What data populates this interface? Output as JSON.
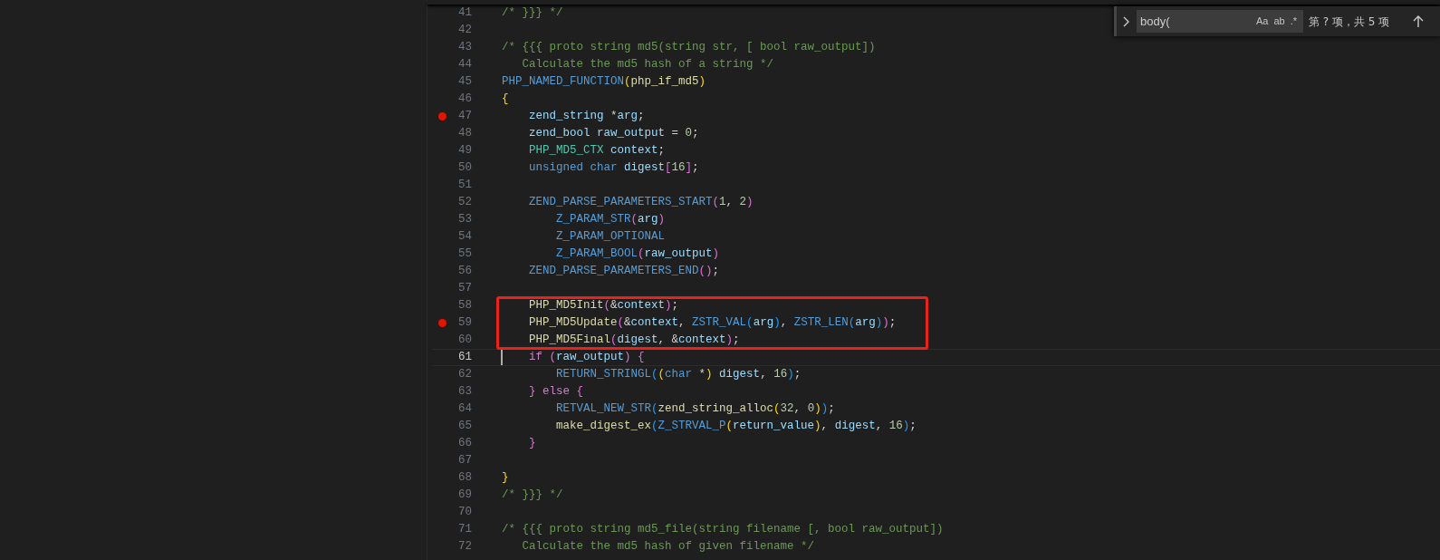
{
  "find_widget": {
    "value": "body(",
    "toggles": [
      {
        "label": "Aa",
        "selected": false
      },
      {
        "label": "ab",
        "selected": false
      },
      {
        "label": ".*",
        "selected": false
      }
    ],
    "result": "第 ? 项，共 5 项"
  },
  "lines": [
    {
      "number": "41",
      "tokens": [
        {
          "kind": "c",
          "text": "/* }}} */"
        }
      ]
    },
    {
      "number": "42"
    },
    {
      "number": "43",
      "tokens": [
        {
          "kind": "c",
          "text": "/* {{{ proto string md5(string str, [ bool raw_output])"
        }
      ]
    },
    {
      "number": "44",
      "tokens": [
        {
          "kind": "c",
          "text": "   Calculate the md5 hash of a string */"
        }
      ]
    },
    {
      "number": "45",
      "tokens": [
        {
          "kind": "m",
          "text": "PHP_NAMED_FUNCTION"
        },
        {
          "kind": "b1",
          "text": "("
        },
        {
          "kind": "f",
          "text": "php_if_md5"
        },
        {
          "kind": "b1",
          "text": ")"
        }
      ]
    },
    {
      "number": "46",
      "tokens": [
        {
          "kind": "b1",
          "text": "{"
        }
      ]
    },
    {
      "number": "47",
      "breakpoint": true,
      "tokens": [
        {
          "kind": "v",
          "text": "    zend_string"
        },
        {
          "kind": "p",
          "text": " *"
        },
        {
          "kind": "v",
          "text": "arg"
        },
        {
          "kind": "p",
          "text": ";"
        }
      ]
    },
    {
      "number": "48",
      "tokens": [
        {
          "kind": "v",
          "text": "    zend_bool raw_output"
        },
        {
          "kind": "p",
          "text": " = "
        },
        {
          "kind": "n",
          "text": "0"
        },
        {
          "kind": "p",
          "text": ";"
        }
      ]
    },
    {
      "number": "49",
      "tokens": [
        {
          "kind": "t",
          "text": "    PHP_MD5_CTX"
        },
        {
          "kind": "v",
          "text": " context"
        },
        {
          "kind": "p",
          "text": ";"
        }
      ]
    },
    {
      "number": "50",
      "tokens": [
        {
          "kind": "k",
          "text": "    unsigned char"
        },
        {
          "kind": "v",
          "text": " digest"
        },
        {
          "kind": "b2",
          "text": "["
        },
        {
          "kind": "n",
          "text": "16"
        },
        {
          "kind": "b2",
          "text": "]"
        },
        {
          "kind": "p",
          "text": ";"
        }
      ]
    },
    {
      "number": "51"
    },
    {
      "number": "52",
      "tokens": [
        {
          "kind": "m",
          "text": "    ZEND_PARSE_PARAMETERS_START"
        },
        {
          "kind": "b2",
          "text": "("
        },
        {
          "kind": "n",
          "text": "1"
        },
        {
          "kind": "p",
          "text": ", "
        },
        {
          "kind": "n",
          "text": "2"
        },
        {
          "kind": "b2",
          "text": ")"
        }
      ]
    },
    {
      "number": "53",
      "tokens": [
        {
          "kind": "m",
          "text": "        Z_PARAM_STR"
        },
        {
          "kind": "b2",
          "text": "("
        },
        {
          "kind": "v",
          "text": "arg"
        },
        {
          "kind": "b2",
          "text": ")"
        }
      ]
    },
    {
      "number": "54",
      "tokens": [
        {
          "kind": "m",
          "text": "        Z_PARAM_OPTIONAL"
        }
      ]
    },
    {
      "number": "55",
      "tokens": [
        {
          "kind": "m",
          "text": "        Z_PARAM_BOOL"
        },
        {
          "kind": "b2",
          "text": "("
        },
        {
          "kind": "v",
          "text": "raw_output"
        },
        {
          "kind": "b2",
          "text": ")"
        }
      ]
    },
    {
      "number": "56",
      "tokens": [
        {
          "kind": "m",
          "text": "    ZEND_PARSE_PARAMETERS_END"
        },
        {
          "kind": "b2",
          "text": "()"
        },
        {
          "kind": "p",
          "text": ";"
        }
      ]
    },
    {
      "number": "57"
    },
    {
      "number": "58",
      "boxed": true,
      "tokens": [
        {
          "kind": "f",
          "text": "    PHP_MD5Init"
        },
        {
          "kind": "b2",
          "text": "("
        },
        {
          "kind": "p",
          "text": "&"
        },
        {
          "kind": "v",
          "text": "context"
        },
        {
          "kind": "b2",
          "text": ")"
        },
        {
          "kind": "p",
          "text": ";"
        }
      ]
    },
    {
      "number": "59",
      "boxed": true,
      "breakpoint": true,
      "tokens": [
        {
          "kind": "f",
          "text": "    PHP_MD5Update"
        },
        {
          "kind": "b2",
          "text": "("
        },
        {
          "kind": "p",
          "text": "&"
        },
        {
          "kind": "v",
          "text": "context"
        },
        {
          "kind": "p",
          "text": ", "
        },
        {
          "kind": "m",
          "text": "ZSTR_VAL"
        },
        {
          "kind": "b3",
          "text": "("
        },
        {
          "kind": "v",
          "text": "arg"
        },
        {
          "kind": "b3",
          "text": ")"
        },
        {
          "kind": "p",
          "text": ", "
        },
        {
          "kind": "m",
          "text": "ZSTR_LEN"
        },
        {
          "kind": "b3",
          "text": "("
        },
        {
          "kind": "v",
          "text": "arg"
        },
        {
          "kind": "b3",
          "text": ")"
        },
        {
          "kind": "b2",
          "text": ")"
        },
        {
          "kind": "p",
          "text": ";"
        }
      ]
    },
    {
      "number": "60",
      "boxed": true,
      "tokens": [
        {
          "kind": "f",
          "text": "    PHP_MD5Final"
        },
        {
          "kind": "b2",
          "text": "("
        },
        {
          "kind": "v",
          "text": "digest"
        },
        {
          "kind": "p",
          "text": ", &"
        },
        {
          "kind": "v",
          "text": "context"
        },
        {
          "kind": "b2",
          "text": ")"
        },
        {
          "kind": "p",
          "text": ";"
        }
      ]
    },
    {
      "number": "61",
      "current": true,
      "tokens": [
        {
          "kind": "k2",
          "text": "    if"
        },
        {
          "kind": "b2",
          "text": " ("
        },
        {
          "kind": "v",
          "text": "raw_output"
        },
        {
          "kind": "b2",
          "text": ") {"
        }
      ]
    },
    {
      "number": "62",
      "tokens": [
        {
          "kind": "m",
          "text": "        RETURN_STRINGL"
        },
        {
          "kind": "b3",
          "text": "("
        },
        {
          "kind": "b1",
          "text": "("
        },
        {
          "kind": "k",
          "text": "char"
        },
        {
          "kind": "p",
          "text": " *"
        },
        {
          "kind": "b1",
          "text": ")"
        },
        {
          "kind": "v",
          "text": " digest"
        },
        {
          "kind": "p",
          "text": ", "
        },
        {
          "kind": "n",
          "text": "16"
        },
        {
          "kind": "b3",
          "text": ")"
        },
        {
          "kind": "p",
          "text": ";"
        }
      ]
    },
    {
      "number": "63",
      "tokens": [
        {
          "kind": "b2",
          "text": "    }"
        },
        {
          "kind": "k2",
          "text": " else"
        },
        {
          "kind": "b2",
          "text": " {"
        }
      ]
    },
    {
      "number": "64",
      "tokens": [
        {
          "kind": "m",
          "text": "        RETVAL_NEW_STR"
        },
        {
          "kind": "b3",
          "text": "("
        },
        {
          "kind": "f",
          "text": "zend_string_alloc"
        },
        {
          "kind": "b1",
          "text": "("
        },
        {
          "kind": "n",
          "text": "32"
        },
        {
          "kind": "p",
          "text": ", "
        },
        {
          "kind": "n",
          "text": "0"
        },
        {
          "kind": "b1",
          "text": ")"
        },
        {
          "kind": "b3",
          "text": ")"
        },
        {
          "kind": "p",
          "text": ";"
        }
      ]
    },
    {
      "number": "65",
      "tokens": [
        {
          "kind": "f",
          "text": "        make_digest_ex"
        },
        {
          "kind": "b3",
          "text": "("
        },
        {
          "kind": "m",
          "text": "Z_STRVAL_P"
        },
        {
          "kind": "b1",
          "text": "("
        },
        {
          "kind": "v",
          "text": "return_value"
        },
        {
          "kind": "b1",
          "text": ")"
        },
        {
          "kind": "p",
          "text": ", "
        },
        {
          "kind": "v",
          "text": "digest"
        },
        {
          "kind": "p",
          "text": ", "
        },
        {
          "kind": "n",
          "text": "16"
        },
        {
          "kind": "b3",
          "text": ")"
        },
        {
          "kind": "p",
          "text": ";"
        }
      ]
    },
    {
      "number": "66",
      "tokens": [
        {
          "kind": "b2",
          "text": "    }"
        }
      ]
    },
    {
      "number": "67"
    },
    {
      "number": "68",
      "tokens": [
        {
          "kind": "b1",
          "text": "}"
        }
      ]
    },
    {
      "number": "69",
      "tokens": [
        {
          "kind": "c",
          "text": "/* }}} */"
        }
      ]
    },
    {
      "number": "70"
    },
    {
      "number": "71",
      "tokens": [
        {
          "kind": "c",
          "text": "/* {{{ proto string md5_file(string filename [, bool raw_output])"
        }
      ]
    },
    {
      "number": "72",
      "tokens": [
        {
          "kind": "c",
          "text": "   Calculate the md5 hash of given filename */"
        }
      ]
    }
  ]
}
